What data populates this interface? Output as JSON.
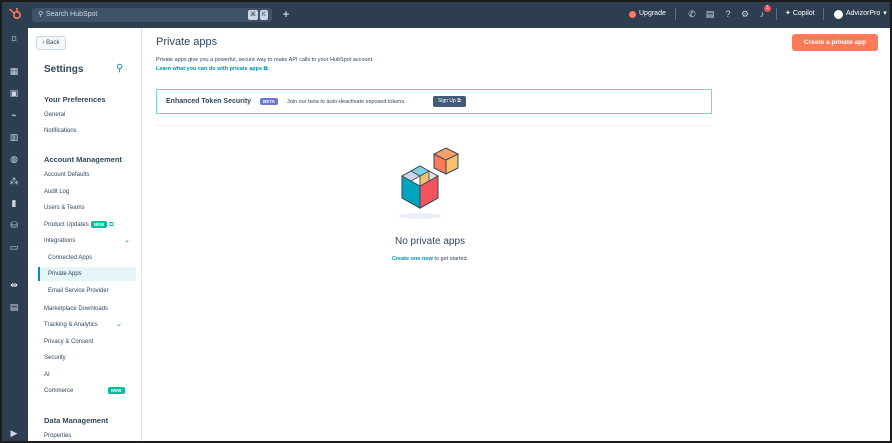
{
  "topbar": {
    "search_placeholder": "Search HubSpot",
    "search_keys": [
      "⌘",
      "K"
    ],
    "upgrade_label": "Upgrade",
    "copilot_label": "Copilot",
    "account_name": "AdvizorPro",
    "notif_count": "1"
  },
  "sidebar": {
    "back_label": "Back",
    "title": "Settings",
    "sections": {
      "prefs": "Your Preferences",
      "account": "Account Management",
      "data": "Data Management"
    },
    "items": {
      "general": "General",
      "notifications": "Notifications",
      "account_defaults": "Account Defaults",
      "audit_log": "Audit Log",
      "users_teams": "Users & Teams",
      "product_updates": "Product Updates",
      "integrations": "Integrations",
      "connected_apps": "Connected Apps",
      "private_apps": "Private Apps",
      "email_provider": "Email Service Provider",
      "marketplace": "Marketplace Downloads",
      "tracking": "Tracking & Analytics",
      "privacy": "Privacy & Consent",
      "security": "Security",
      "ai": "AI",
      "commerce": "Commerce",
      "properties": "Properties"
    },
    "new_tag": "NEW"
  },
  "main": {
    "title": "Private apps",
    "create_button": "Create a private app",
    "description": "Private apps give you a powerful, secure way to make API calls to your HubSpot account.",
    "learn_link": "Learn what you can do with private apps",
    "learn_suffix": ".",
    "banner": {
      "title": "Enhanced Token Security",
      "beta": "BETA",
      "text": "Join our beta to auto-deactivate exposed tokens.",
      "signup": "Sign Up"
    },
    "empty_title": "No private apps",
    "empty_link": "Create one now",
    "empty_suffix": " to get started."
  },
  "colors": {
    "topbar": "#2d3e50",
    "accent": "#ff7a59",
    "link": "#0091ae",
    "new_tag": "#00bda5",
    "beta_tag": "#6a78d1"
  }
}
